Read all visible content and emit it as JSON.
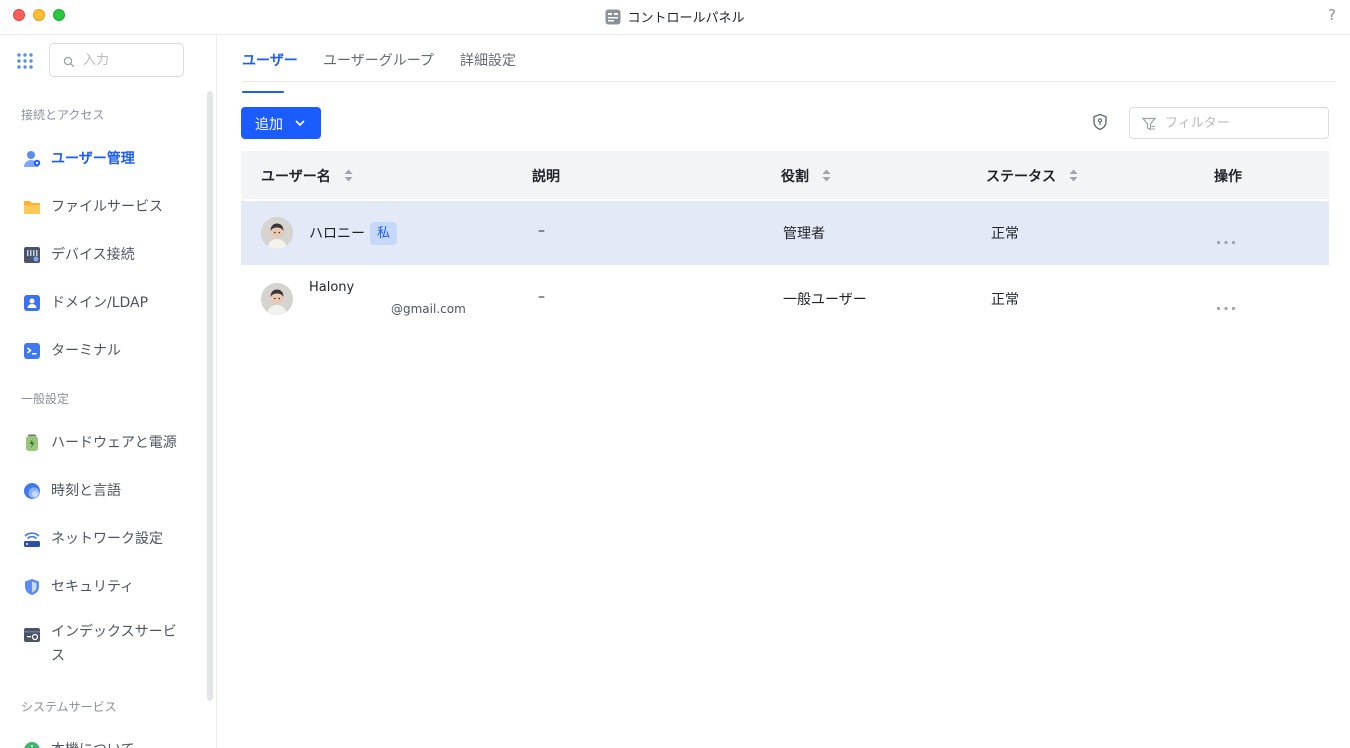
{
  "window": {
    "title": "コントロールパネル",
    "help_label": "?"
  },
  "sidebar": {
    "search_placeholder": "入力",
    "sections": [
      {
        "label": "接続とアクセス"
      },
      {
        "label": "一般設定"
      },
      {
        "label": "システムサービス"
      }
    ],
    "items": [
      {
        "label": "ユーザー管理",
        "icon": "user-manage-icon",
        "active": true
      },
      {
        "label": "ファイルサービス",
        "icon": "folder-icon"
      },
      {
        "label": "デバイス接続",
        "icon": "device-connect-icon"
      },
      {
        "label": "ドメイン/LDAP",
        "icon": "domain-ldap-icon"
      },
      {
        "label": "ターミナル",
        "icon": "terminal-icon"
      },
      {
        "label": "ハードウェアと電源",
        "icon": "hardware-power-icon"
      },
      {
        "label": "時刻と言語",
        "icon": "globe-icon"
      },
      {
        "label": "ネットワーク設定",
        "icon": "network-icon"
      },
      {
        "label": "セキュリティ",
        "icon": "security-shield-icon"
      },
      {
        "label": "インデックスサービス",
        "icon": "index-service-icon"
      },
      {
        "label": "本機について",
        "icon": "info-icon"
      }
    ]
  },
  "tabs": [
    {
      "label": "ユーザー",
      "active": true
    },
    {
      "label": "ユーザーグループ"
    },
    {
      "label": "詳細設定"
    }
  ],
  "toolbar": {
    "add_label": "追加",
    "filter_placeholder": "フィルター"
  },
  "table": {
    "columns": [
      "ユーザー名",
      "説明",
      "役割",
      "ステータス",
      "操作"
    ],
    "rows": [
      {
        "name": "ハロニー",
        "badge": "私",
        "email": "",
        "description": "–",
        "role": "管理者",
        "status": "正常",
        "selected": true
      },
      {
        "name": "Halony",
        "badge": "",
        "email": "@gmail.com",
        "description": "–",
        "role": "一般ユーザー",
        "status": "正常",
        "selected": false
      }
    ]
  },
  "colors": {
    "accent": "#1a5cff",
    "selected_row": "#e3e9f6",
    "header_bg": "#f3f4f6"
  }
}
